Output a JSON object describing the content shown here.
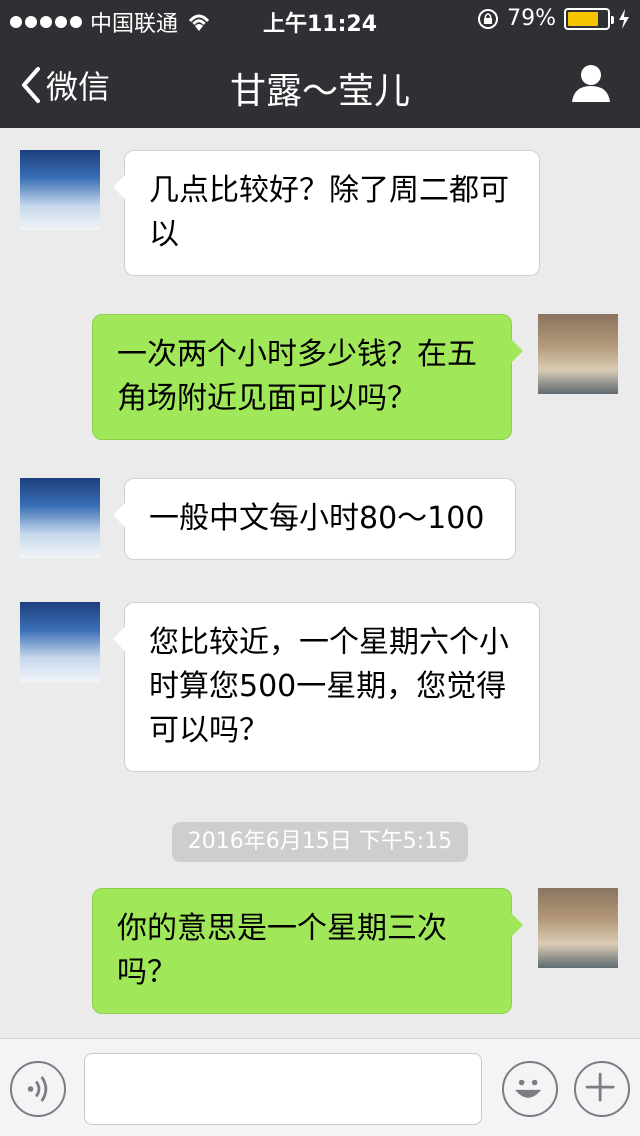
{
  "status_bar": {
    "carrier": "中国联通",
    "time": "上午11:24",
    "battery_percent": "79%",
    "battery_level": 0.79,
    "battery_color": "#f7c500"
  },
  "nav": {
    "back_label": "微信",
    "title": "甘露～莹儿"
  },
  "messages": [
    {
      "direction": "in",
      "avatar": "sky",
      "text": "几点比较好？除了周二都可以"
    },
    {
      "direction": "out",
      "avatar": "street",
      "text": "一次两个小时多少钱？在五角场附近见面可以吗？"
    },
    {
      "direction": "in",
      "avatar": "sky",
      "text": "一般中文每小时80～100"
    },
    {
      "direction": "in",
      "avatar": "sky",
      "text": "您比较近，一个星期六个小时算您500一星期，您觉得可以吗？"
    },
    {
      "direction": "out",
      "avatar": "street",
      "text": "你的意思是一个星期三次吗？"
    }
  ],
  "timestamp": "2016年6月15日 下午5:15",
  "input_bar": {
    "icons": [
      "voice-icon",
      "emoji-icon",
      "plus-icon"
    ],
    "value": ""
  },
  "colors": {
    "nav_bg": "#2e3034",
    "outgoing_bubble": "#a0e75a",
    "incoming_bubble": "#ffffff",
    "chat_bg": "#ebebeb"
  }
}
